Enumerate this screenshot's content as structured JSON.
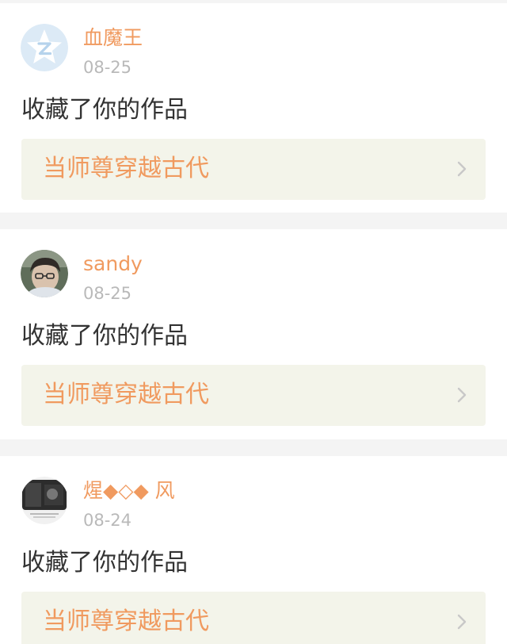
{
  "feed": {
    "items": [
      {
        "username": "血魔王",
        "date": "08-25",
        "action": "收藏了你的作品",
        "work_title": "当师尊穿越古代",
        "avatar_icon": "qzone-star-icon"
      },
      {
        "username": "sandy",
        "date": "08-25",
        "action": "收藏了你的作品",
        "work_title": "当师尊穿越古代",
        "avatar_icon": "user-photo-avatar"
      },
      {
        "username": "煋◆◇◆ 风",
        "date": "08-24",
        "action": "收藏了你的作品",
        "work_title": "当师尊穿越古代",
        "avatar_icon": "user-photo-avatar"
      }
    ]
  },
  "colors": {
    "page_bg": "#f4f4f4",
    "card_bg": "#ffffff",
    "accent_orange": "#f09a5f",
    "date_gray": "#b9b9b9",
    "text_dark": "#333333",
    "link_bg": "#f3f4ea",
    "chevron_gray": "#c8c8c8"
  }
}
